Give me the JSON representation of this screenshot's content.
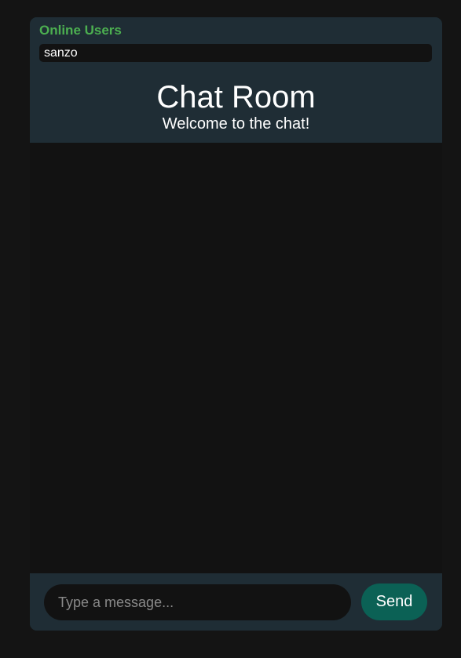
{
  "sidebar": {
    "title": "Online Users",
    "users": [
      "sanzo"
    ]
  },
  "header": {
    "title": "Chat Room",
    "subtitle": "Welcome to the chat!"
  },
  "messages": [],
  "composer": {
    "placeholder": "Type a message...",
    "value": "",
    "send_label": "Send"
  },
  "colors": {
    "page_background": "#141414",
    "panel_background": "#1f2d35",
    "message_area_background": "#121212",
    "online_title": "#4caf50",
    "send_button": "#0b6155"
  }
}
